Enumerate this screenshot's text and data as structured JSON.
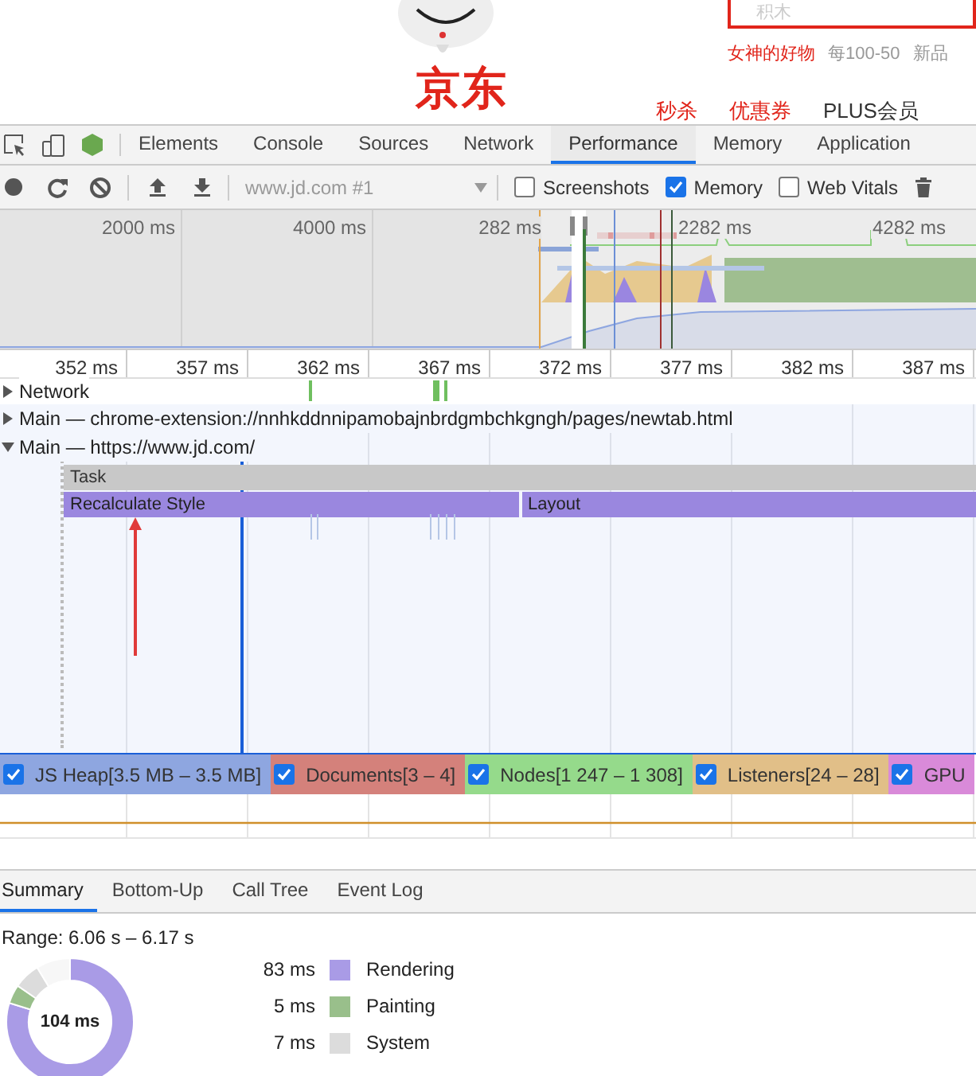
{
  "website": {
    "logo": "京东",
    "search": {
      "placeholder": "积木"
    },
    "hot_words": [
      {
        "text": "女神的好物",
        "highlighted": true
      },
      {
        "text": "每100-50",
        "highlighted": false
      },
      {
        "text": "新品",
        "highlighted": false
      }
    ],
    "nav": [
      {
        "text": "秒杀",
        "highlighted": true
      },
      {
        "text": "优惠券",
        "highlighted": true
      },
      {
        "text": "PLUS会员",
        "highlighted": false
      }
    ]
  },
  "devtools": {
    "tabs": [
      {
        "label": "Elements",
        "selected": false
      },
      {
        "label": "Console",
        "selected": false
      },
      {
        "label": "Sources",
        "selected": false
      },
      {
        "label": "Network",
        "selected": false
      },
      {
        "label": "Performance",
        "selected": true
      },
      {
        "label": "Memory",
        "selected": false
      },
      {
        "label": "Application",
        "selected": false
      }
    ],
    "toolbar": {
      "target": "www.jd.com #1",
      "options": [
        {
          "label": "Screenshots",
          "checked": false
        },
        {
          "label": "Memory",
          "checked": true
        },
        {
          "label": "Web Vitals",
          "checked": false
        }
      ]
    },
    "overview": {
      "ticks": [
        "2000 ms",
        "4000 ms",
        "282 ms",
        "2282 ms",
        "4282 ms"
      ]
    },
    "ruler": {
      "ticks": [
        "352 ms",
        "357 ms",
        "362 ms",
        "367 ms",
        "372 ms",
        "377 ms",
        "382 ms",
        "387 ms"
      ]
    },
    "tracks": [
      {
        "label": "Network",
        "expanded": false
      },
      {
        "label": "Main — chrome-extension://nnhkddnnipamobajnbrdgmbchkgngh/pages/newtab.html",
        "expanded": false
      },
      {
        "label": "Main — https://www.jd.com/",
        "expanded": true
      }
    ],
    "flame": [
      {
        "kind": "task",
        "items": [
          "Task"
        ]
      },
      {
        "kind": "rendering",
        "items": [
          "Recalculate Style",
          "Layout"
        ]
      }
    ],
    "counters": [
      {
        "label": "JS Heap[3.5 MB – 3.5 MB]",
        "checked": true,
        "color": "#8ea6e0"
      },
      {
        "label": "Documents[3 – 4]",
        "checked": true,
        "color": "#d4817b"
      },
      {
        "label": "Nodes[1 247 – 1 308]",
        "checked": true,
        "color": "#95da8b"
      },
      {
        "label": "Listeners[24 – 28]",
        "checked": true,
        "color": "#e1bf88"
      },
      {
        "label": "GPU",
        "checked": true,
        "color": "#d98ad9"
      }
    ],
    "details": {
      "tabs": [
        {
          "label": "Summary",
          "selected": true
        },
        {
          "label": "Bottom-Up",
          "selected": false
        },
        {
          "label": "Call Tree",
          "selected": false
        },
        {
          "label": "Event Log",
          "selected": false
        }
      ],
      "range": "Range: 6.06 s – 6.17 s",
      "summary": {
        "total": "104 ms",
        "items": [
          {
            "value": "83 ms",
            "label": "Rendering",
            "color": "#a99be6"
          },
          {
            "value": "5 ms",
            "label": "Painting",
            "color": "#99bf8b"
          },
          {
            "value": "7 ms",
            "label": "System",
            "color": "#dcdcdc"
          }
        ]
      }
    }
  }
}
